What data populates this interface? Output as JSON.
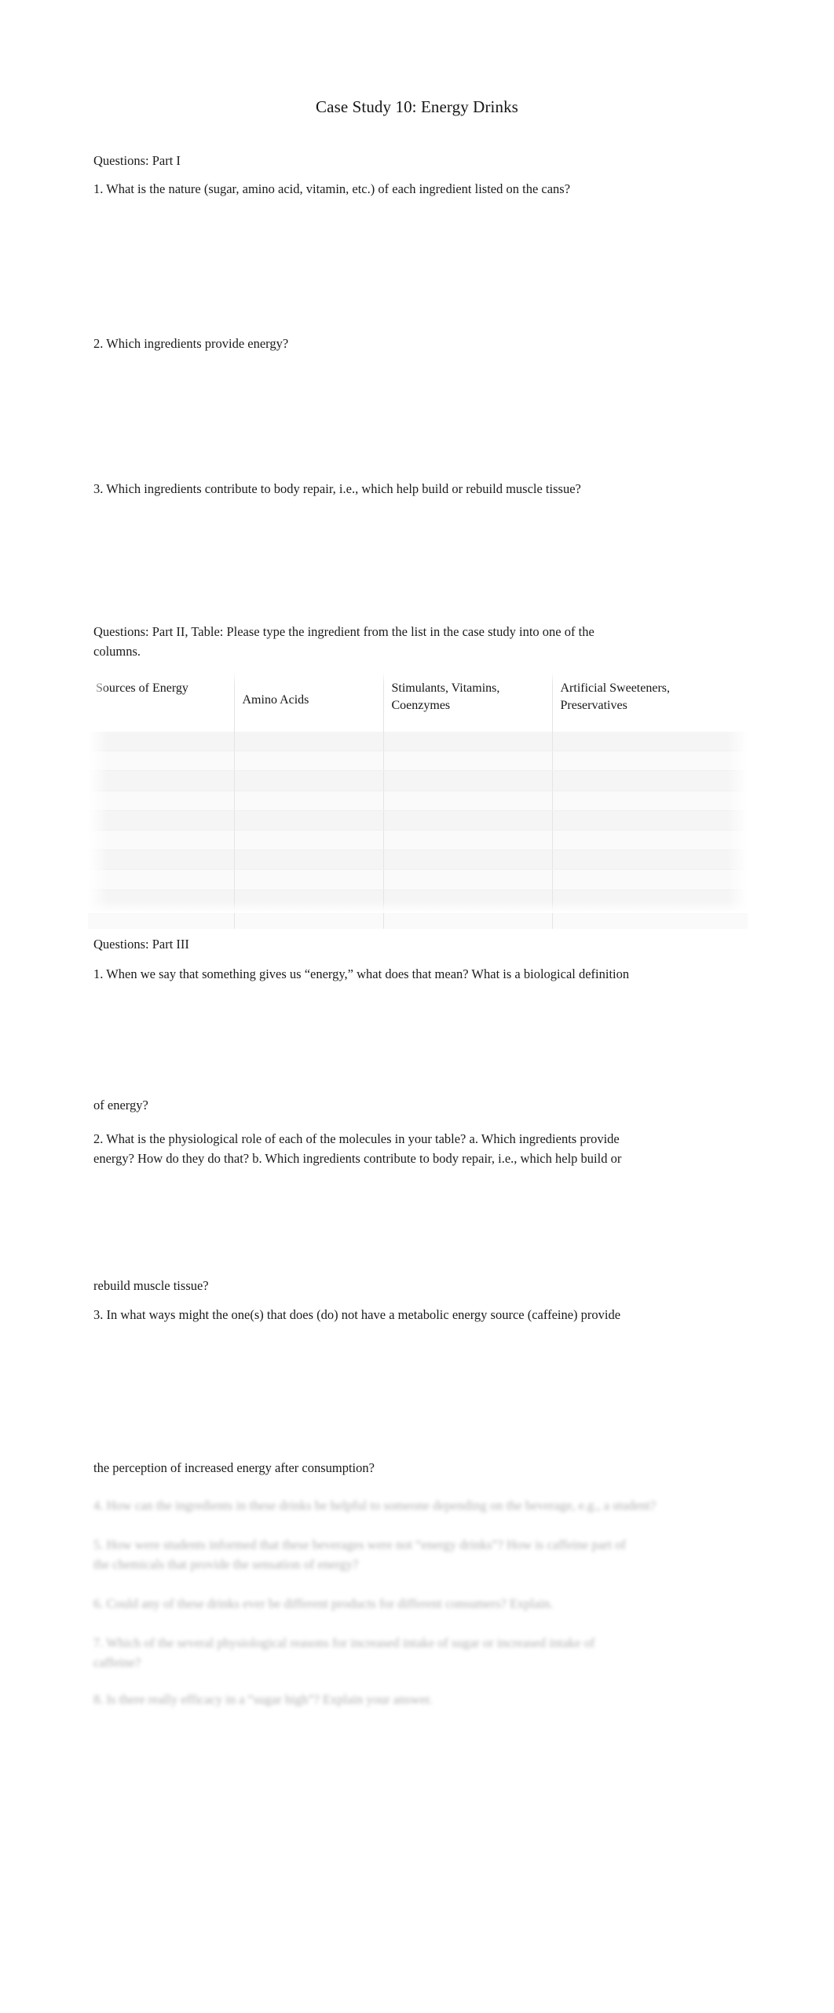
{
  "document": {
    "title": "Case Study 10: Energy Drinks"
  },
  "part_one": {
    "heading": "Questions: Part I",
    "questions": [
      "1. What is the nature (sugar, amino acid, vitamin, etc.) of each ingredient listed on the cans?",
      "2. Which ingredients provide energy?",
      "3. Which ingredients contribute to body repair, i.e., which help build or rebuild muscle tissue?"
    ]
  },
  "part_two": {
    "heading_line1": " Questions: Part II, Table: Please type the ingredient from the list in the case study into one of the",
    "heading_line2": "columns.",
    "table": {
      "columns": [
        "Sources of Energy",
        "Amino Acids",
        "Stimulants, Vitamins, Coenzymes",
        "Artificial Sweeteners, Preservatives"
      ],
      "row_count": 10,
      "rows": [
        [
          "",
          "",
          "",
          ""
        ],
        [
          "",
          "",
          "",
          ""
        ],
        [
          "",
          "",
          "",
          ""
        ],
        [
          "",
          "",
          "",
          ""
        ],
        [
          "",
          "",
          "",
          ""
        ],
        [
          "",
          "",
          "",
          ""
        ],
        [
          "",
          "",
          "",
          ""
        ],
        [
          "",
          "",
          "",
          ""
        ],
        [
          "",
          "",
          "",
          ""
        ],
        [
          "",
          "",
          "",
          ""
        ]
      ]
    }
  },
  "part_three": {
    "heading": "Questions: Part III",
    "q1_line1": "1. When we say that something gives us “energy,” what does that mean? What is a biological definition",
    "q1_line2": "of energy?",
    "q2_line1": "2. What is the physiological role of each of the molecules in your table? a. Which ingredients provide",
    "q2_line2": "energy? How do they do that? b. Which ingredients contribute to body repair, i.e., which help build or",
    "q2_line3": "rebuild muscle tissue?",
    "q3_line1": "3. In what ways might the one(s) that does (do) not have a metabolic energy source (caffeine) provide",
    "q3_line2": "the perception of increased energy after consumption?"
  },
  "preview_blurred": {
    "q4": "4. How can the ingredients in these drinks be helpful to someone depending on the beverage, e.g., a student?",
    "q5_line1": "5. How were students informed that these beverages were not “energy drinks”? How is caffeine part of",
    "q5_line2": "the chemicals that provide the sensation of energy?",
    "q6": "6. Could any of these drinks ever be different products for different consumers? Explain.",
    "q7_line1": "7. Which of the several physiological reasons for increased intake of sugar or increased intake of",
    "q7_line2": "caffeine?",
    "q8": "8. Is there really efficacy in a “sugar high”? Explain your answer."
  }
}
